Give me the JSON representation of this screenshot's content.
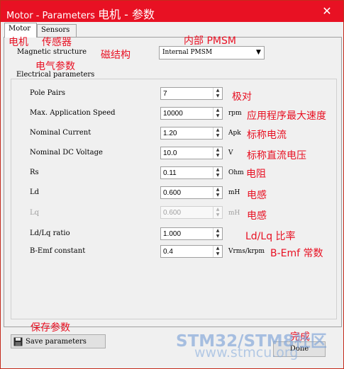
{
  "window": {
    "title": "Motor - Parameters",
    "title_annotation": "电机 - 参数",
    "close_label": "✕"
  },
  "tabs": [
    {
      "label": "Motor",
      "annotation": "电机",
      "active": true
    },
    {
      "label": "Sensors",
      "annotation": "传感器",
      "active": false
    }
  ],
  "magnetic_structure": {
    "label": "Magnetic structure",
    "annotation": "磁结构",
    "value": "Internal PMSM",
    "value_annotation": "内部 PMSM"
  },
  "electrical": {
    "group_label": "Electrical parameters",
    "group_annotation": "电气参数",
    "rows": [
      {
        "label": "Pole Pairs",
        "value": "7",
        "unit": "",
        "annotation": "极对",
        "enabled": true
      },
      {
        "label": "Max. Application Speed",
        "value": "10000",
        "unit": "rpm",
        "annotation": "应用程序最大速度",
        "enabled": true
      },
      {
        "label": "Nominal Current",
        "value": "1.20",
        "unit": "Apk",
        "annotation": "标称电流",
        "enabled": true
      },
      {
        "label": "Nominal DC Voltage",
        "value": "10.0",
        "unit": "V",
        "annotation": "标称直流电压",
        "enabled": true
      },
      {
        "label": "Rs",
        "value": "0.11",
        "unit": "Ohm",
        "annotation": "电阻",
        "enabled": true
      },
      {
        "label": "Ld",
        "value": "0.600",
        "unit": "mH",
        "annotation": "电感",
        "enabled": true
      },
      {
        "label": "Lq",
        "value": "0.600",
        "unit": "mH",
        "annotation": "电感",
        "enabled": false
      },
      {
        "label": "Ld/Lq ratio",
        "value": "1.000",
        "unit": "",
        "annotation": "Ld/Lq 比率",
        "enabled": true
      },
      {
        "label": "B-Emf constant",
        "value": "0.4",
        "unit": "Vrms/krpm",
        "annotation": "B-Emf 常数",
        "enabled": true
      }
    ]
  },
  "footer": {
    "save_label": "Save parameters",
    "save_annotation": "保存参数",
    "done_label": "Done",
    "done_annotation": "完成"
  },
  "watermark": {
    "line1": "STM32/STM8社区",
    "line2": "www.stmcu.org"
  }
}
